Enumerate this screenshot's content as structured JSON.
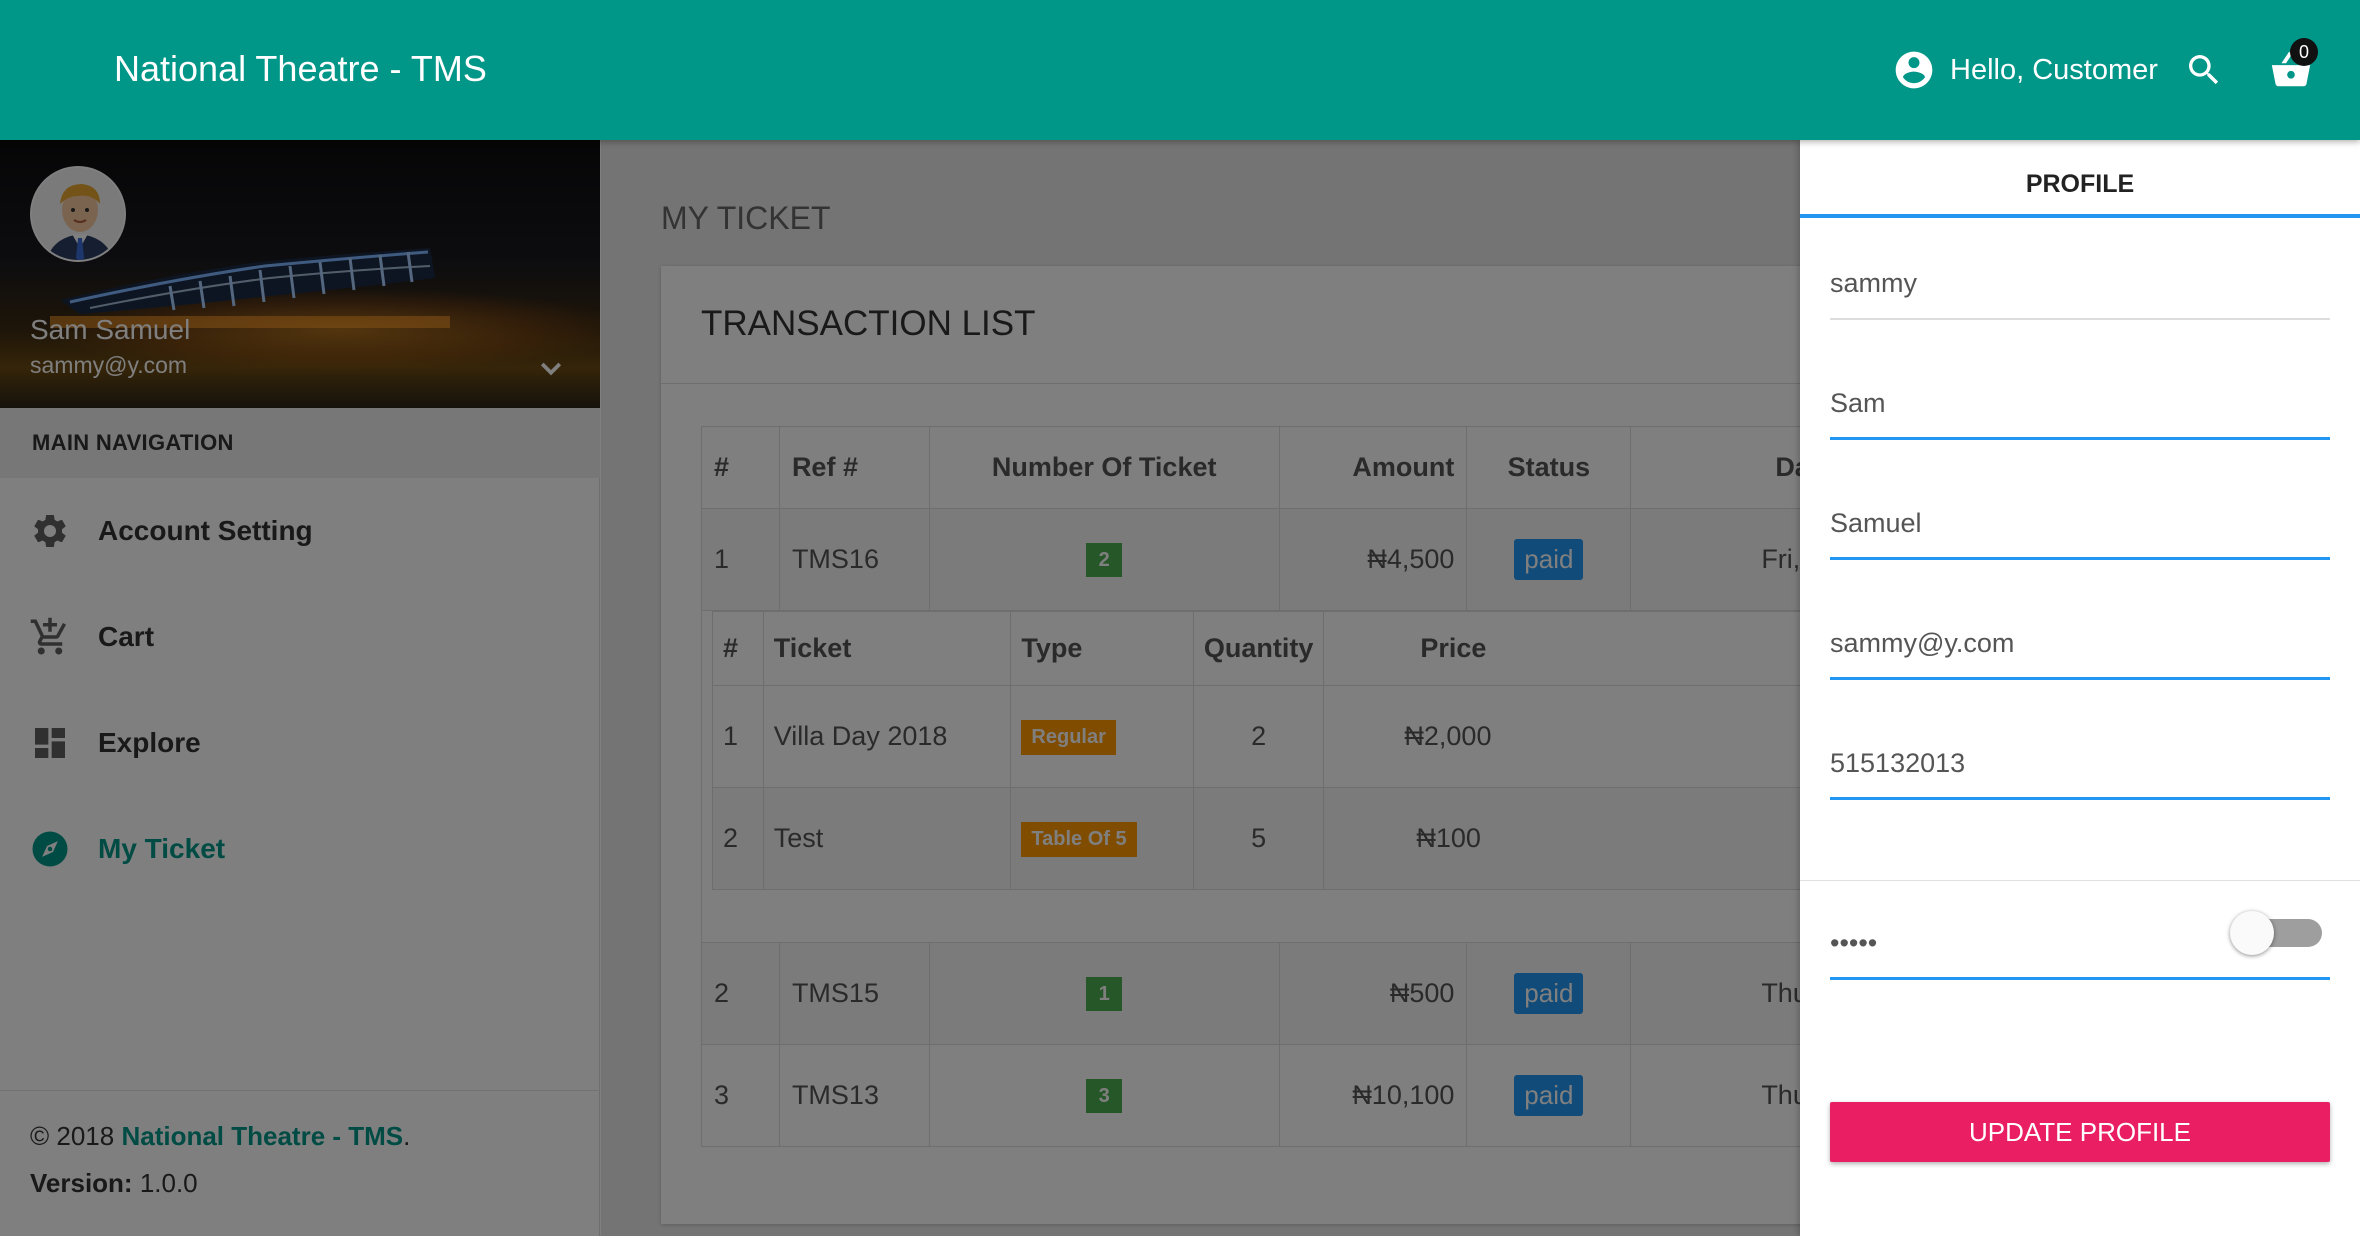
{
  "app": {
    "title": "National Theatre - TMS"
  },
  "header": {
    "greeting": "Hello, Customer",
    "cart_count": "0"
  },
  "sidebar": {
    "user_name": "Sam Samuel",
    "user_email": "sammy@y.com",
    "nav_header": "MAIN NAVIGATION",
    "items": [
      {
        "label": "Account Setting",
        "icon": "gear-icon"
      },
      {
        "label": "Cart",
        "icon": "cart-add-icon"
      },
      {
        "label": "Explore",
        "icon": "dashboard-icon"
      },
      {
        "label": "My Ticket",
        "icon": "compass-icon",
        "active": true
      }
    ],
    "footer": {
      "copyright": "© 2018 ",
      "brand": "National Theatre - TMS",
      "period": ".",
      "version_label": "Version:",
      "version": " 1.0.0"
    }
  },
  "page": {
    "title": "MY TICKET",
    "card_title": "TRANSACTION LIST"
  },
  "transactions": {
    "headers": [
      "#",
      "Ref #",
      "Number Of Ticket",
      "Amount",
      "Status",
      "Da"
    ],
    "rows": [
      {
        "n": "1",
        "ref": "TMS16",
        "count": "2",
        "amount": "₦4,500",
        "status": "paid",
        "date": "Fri, Ma"
      },
      {
        "n": "2",
        "ref": "TMS15",
        "count": "1",
        "amount": "₦500",
        "status": "paid",
        "date": "Thu, Ma"
      },
      {
        "n": "3",
        "ref": "TMS13",
        "count": "3",
        "amount": "₦10,100",
        "status": "paid",
        "date": "Thu, Ma"
      }
    ],
    "detail": {
      "headers": [
        "#",
        "Ticket",
        "Type",
        "Quantity",
        "Price"
      ],
      "rows": [
        {
          "n": "1",
          "ticket": "Villa Day 2018",
          "type": "Regular",
          "qty": "2",
          "price": "₦2,000"
        },
        {
          "n": "2",
          "ticket": "Test",
          "type": "Table Of 5",
          "qty": "5",
          "price": "₦100"
        }
      ]
    }
  },
  "profile": {
    "tab": "PROFILE",
    "username": "sammy",
    "first_name": "Sam",
    "last_name": "Samuel",
    "email": "sammy@y.com",
    "phone": "515132013",
    "password": "•••••",
    "button": "UPDATE PROFILE"
  },
  "colors": {
    "primary": "#009688",
    "accent": "#e91e63",
    "tab_underline": "#2196f3",
    "badge_green": "#4caf50",
    "badge_orange": "#ff9800",
    "badge_blue": "#2196f3"
  }
}
